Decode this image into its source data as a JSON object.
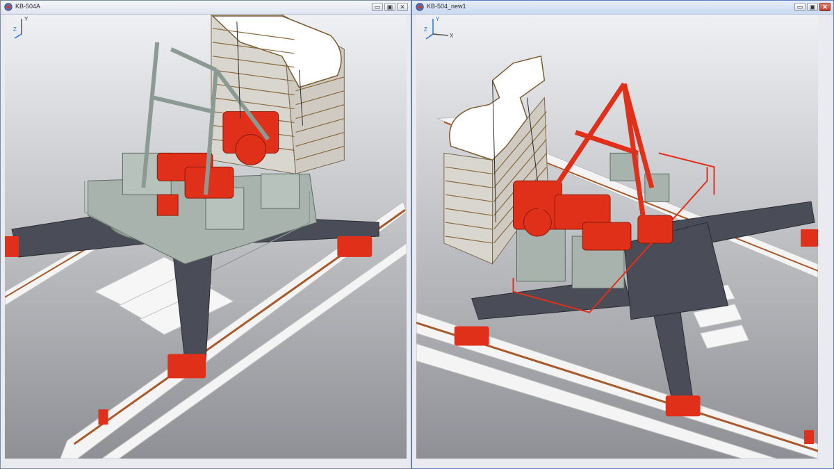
{
  "windows": [
    {
      "title": "KB-504A",
      "active": false
    },
    {
      "title": "KB-504_new1",
      "active": true
    }
  ],
  "window_controls": {
    "minimize": "▭",
    "restore": "▣",
    "close": "✕"
  },
  "axes": {
    "left_labels": [
      "Y",
      "Z"
    ],
    "right_labels": [
      "Y",
      "X",
      "Z"
    ]
  },
  "colors": {
    "crane_red": "#e0301a",
    "steel_gray": "#4a4c58",
    "housing_gray": "#a9b3ad",
    "rail_brown": "#a85a2a",
    "bg_top": "#eef0f3",
    "bg_bottom": "#8e9095",
    "active_border": "#5a7fb8"
  },
  "icons": {
    "app": "crane-app-icon",
    "minimize": "minimize-icon",
    "restore": "restore-icon",
    "close": "close-icon",
    "axis": "axis-triad-icon"
  }
}
